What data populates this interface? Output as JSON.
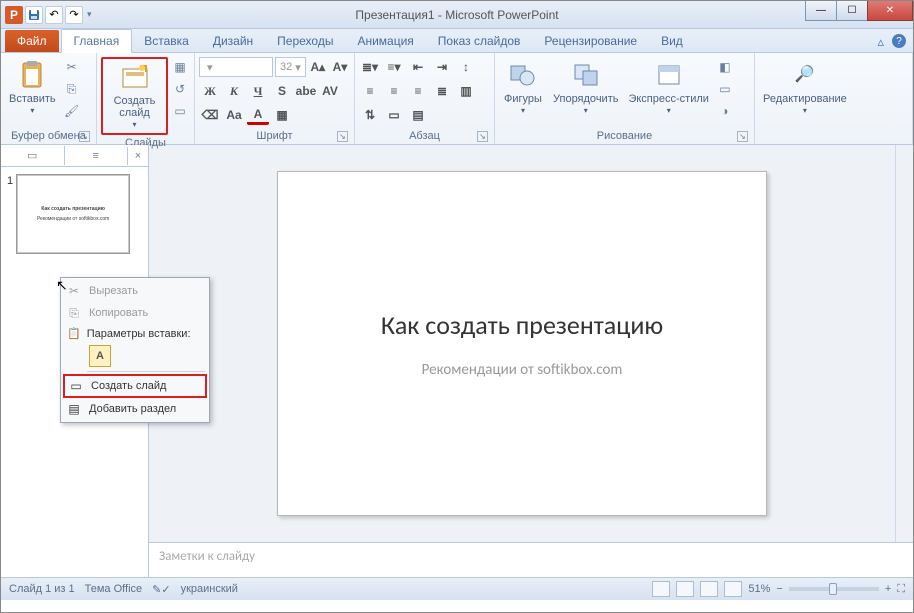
{
  "title": "Презентация1 - Microsoft PowerPoint",
  "qat": {
    "app_letter": "P"
  },
  "tabs": {
    "file": "Файл",
    "home": "Главная",
    "insert": "Вставка",
    "design": "Дизайн",
    "transitions": "Переходы",
    "animations": "Анимация",
    "slideshow": "Показ слайдов",
    "review": "Рецензирование",
    "view": "Вид"
  },
  "ribbon": {
    "clipboard": {
      "paste": "Вставить",
      "label": "Буфер обмена"
    },
    "slides": {
      "new_slide": "Создать слайд",
      "label": "Слайды"
    },
    "font": {
      "size": "32",
      "label": "Шрифт"
    },
    "paragraph": {
      "label": "Абзац"
    },
    "drawing": {
      "shapes": "Фигуры",
      "arrange": "Упорядочить",
      "styles": "Экспресс-стили",
      "label": "Рисование"
    },
    "editing": {
      "label": "Редактирование"
    }
  },
  "slide_panel": {
    "number": "1"
  },
  "slide": {
    "title": "Как создать презентацию",
    "subtitle": "Рекомендации от softikbox.com"
  },
  "notes": {
    "placeholder": "Заметки к слайду"
  },
  "context_menu": {
    "cut": "Вырезать",
    "copy": "Копировать",
    "paste_options": "Параметры вставки:",
    "paste_opt_a": "A",
    "new_slide": "Создать слайд",
    "add_section": "Добавить раздел"
  },
  "status": {
    "slide_info": "Слайд 1 из 1",
    "theme": "Тема Office",
    "lang": "украинский",
    "zoom": "51%"
  }
}
